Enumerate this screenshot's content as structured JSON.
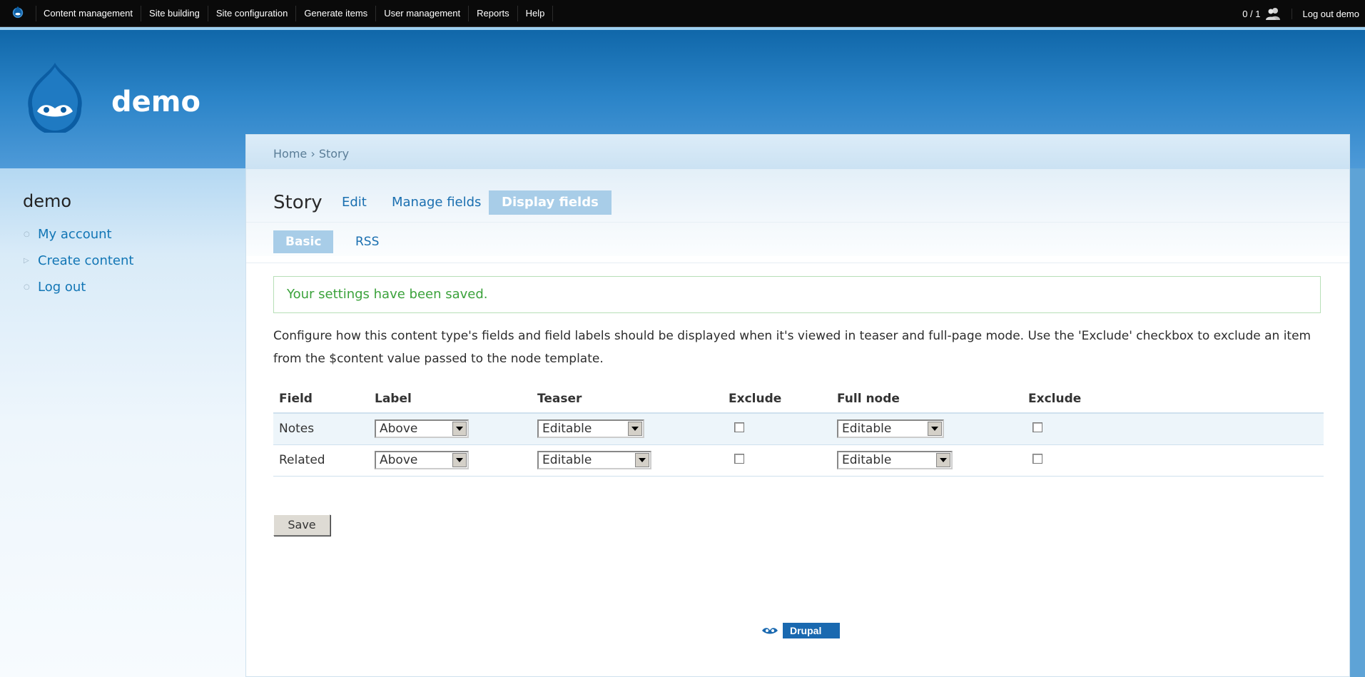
{
  "toolbar": {
    "menu": [
      "Content management",
      "Site building",
      "Site configuration",
      "Generate items",
      "User management",
      "Reports",
      "Help"
    ],
    "counter": "0 / 1",
    "logout_label": "Log out demo"
  },
  "header": {
    "site_name": "demo"
  },
  "sidebar": {
    "title": "demo",
    "items": [
      {
        "label": "My account",
        "bullet": "○"
      },
      {
        "label": "Create content",
        "bullet": "▷"
      },
      {
        "label": "Log out",
        "bullet": "○"
      }
    ]
  },
  "breadcrumb": {
    "text": "Home › Story"
  },
  "page": {
    "title": "Story"
  },
  "tabs": {
    "primary": [
      {
        "label": "Edit",
        "active": false
      },
      {
        "label": "Manage fields",
        "active": false
      },
      {
        "label": "Display fields",
        "active": true
      }
    ],
    "secondary": [
      {
        "label": "Basic",
        "active": true
      },
      {
        "label": "RSS",
        "active": false
      }
    ]
  },
  "status_message": "Your settings have been saved.",
  "help_text": "Configure how this content type's fields and field labels should be displayed when it's viewed in teaser and full-page mode. Use the 'Exclude' checkbox to exclude an item from the $content value passed to the node template.",
  "table": {
    "headers": [
      "Field",
      "Label",
      "Teaser",
      "Exclude",
      "Full node",
      "Exclude"
    ],
    "rows": [
      {
        "field": "Notes",
        "label": "Above",
        "teaser": "Editable",
        "teaser_exclude": false,
        "full": "Editable",
        "full_exclude": false
      },
      {
        "field": "Related",
        "label": "Above",
        "teaser": "Editable",
        "teaser_exclude": false,
        "full": "Editable",
        "full_exclude": false
      }
    ]
  },
  "save_label": "Save",
  "footer": {
    "powered_label": "Drupal"
  },
  "colors": {
    "brand_blue": "#0f66a8",
    "link": "#1a6fb0",
    "status_green": "#3ba23b",
    "active_tab": "#a8cde8"
  }
}
